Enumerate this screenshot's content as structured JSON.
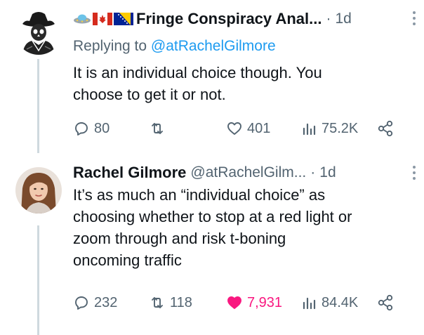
{
  "tweets": [
    {
      "flags": [
        "🛸",
        "🇨🇦",
        "🇧🇦"
      ],
      "author_name": "Fringe Conspiracy Anal...",
      "dot": "·",
      "time": "1d",
      "replying_prefix": "Replying to",
      "replying_handle": "@atRachelGilmore",
      "text_lines": [
        "It is an individual choice though. You",
        "choose to get it or not."
      ],
      "stats": {
        "replies": "80",
        "reposts": "",
        "likes": "401",
        "views": "75.2K"
      },
      "like_state": "not_liked"
    },
    {
      "author_name": "Rachel Gilmore",
      "handle": "@atRachelGilm...",
      "dot": "·",
      "time": "1d",
      "text_lines": [
        "It’s as much an “individual choice” as",
        "choosing whether to stop at a red light or",
        "zoom through and risk t-boning",
        "oncoming traffic"
      ],
      "stats": {
        "replies": "232",
        "reposts": "118",
        "likes": "7,931",
        "views": "84.4K"
      },
      "like_state": "liked"
    }
  ],
  "icons": {
    "avatar_1": "skull-cowboy-avatar",
    "avatar_2": "woman-portrait-avatar",
    "reply": "reply-icon",
    "repost": "repost-icon",
    "like": "heart-icon",
    "views": "views-icon",
    "share": "share-icon",
    "more": "more-icon"
  },
  "colors": {
    "link": "#1d9bf0",
    "muted": "#536471",
    "like_active": "#f91880",
    "thread_line": "#cfd9de"
  }
}
